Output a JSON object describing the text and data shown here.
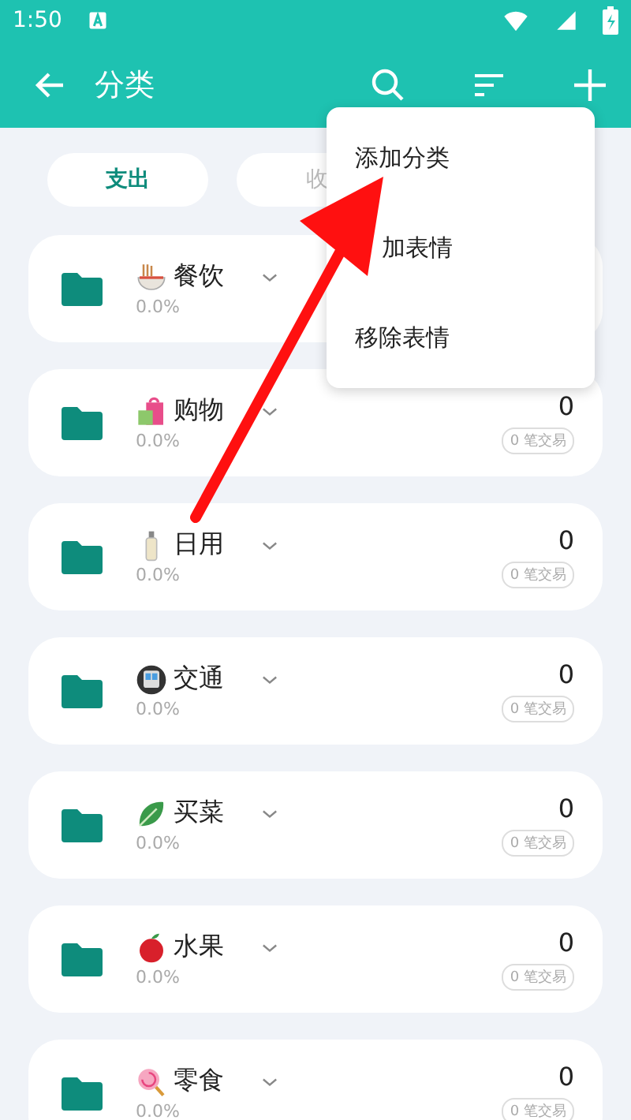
{
  "status_bar": {
    "time": "1:50"
  },
  "app_bar": {
    "title": "分类"
  },
  "type_tabs": [
    {
      "label": "支出",
      "selected": true
    },
    {
      "label": "收",
      "selected": false
    }
  ],
  "categories": [
    {
      "kind": "noodles",
      "name": "餐饮",
      "percent": "0.0%"
    },
    {
      "kind": "bag",
      "name": "购物",
      "percent": "0.0%",
      "amount": "0",
      "count": "0 笔交易"
    },
    {
      "kind": "bottle",
      "name": "日用",
      "percent": "0.0%",
      "amount": "0",
      "count": "0 笔交易"
    },
    {
      "kind": "train",
      "name": "交通",
      "percent": "0.0%",
      "amount": "0",
      "count": "0 笔交易"
    },
    {
      "kind": "leaf",
      "name": "买菜",
      "percent": "0.0%",
      "amount": "0",
      "count": "0 笔交易"
    },
    {
      "kind": "apple",
      "name": "水果",
      "percent": "0.0%",
      "amount": "0",
      "count": "0 笔交易"
    },
    {
      "kind": "lollipop",
      "name": "零食",
      "percent": "0.0%",
      "amount": "0",
      "count": "0 笔交易"
    }
  ],
  "menu": {
    "items": [
      "添加分类",
      "加表情",
      "移除表情"
    ]
  }
}
